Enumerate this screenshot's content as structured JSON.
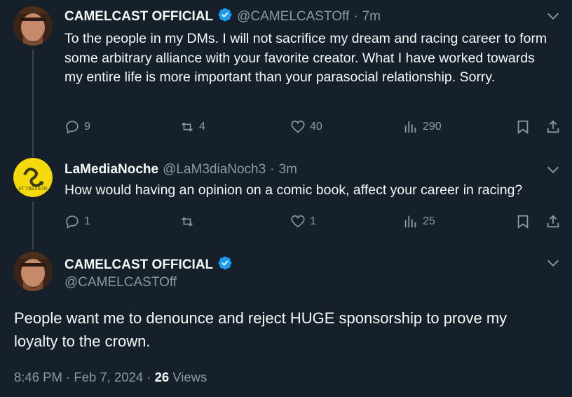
{
  "tweet1": {
    "name": "CAMELCAST OFFICIAL",
    "handle": "@CAMELCASTOff",
    "time": "7m",
    "text": "To the people in my DMs. I will not sacrifice my dream and racing career to form some arbitrary alliance with your favorite creator. What I have worked towards my entire life is more important than your parasocial relationship. Sorry.",
    "replies": "9",
    "retweets": "4",
    "likes": "40",
    "views": "290"
  },
  "tweet2": {
    "name": "LaMediaNoche",
    "handle": "@LaM3diaNoch3",
    "time": "3m",
    "avatar_caption": "ST TREASON",
    "text": "How would having an opinion on a comic book, affect your career in racing?",
    "replies": "1",
    "retweets": "",
    "likes": "1",
    "views": "25"
  },
  "tweet3": {
    "name": "CAMELCAST OFFICIAL",
    "handle": "@CAMELCASTOff",
    "text": "People want me to denounce and reject HUGE sponsorship to prove my loyalty to the crown.",
    "time": "8:46 PM",
    "date": "Feb 7, 2024",
    "views_count": "26",
    "views_label": "Views"
  },
  "separator": "·",
  "colors": {
    "background": "#15202b",
    "text": "#f7f9f9",
    "muted": "#8b98a5",
    "verified": "#1d9bf0",
    "line": "#38444d"
  }
}
